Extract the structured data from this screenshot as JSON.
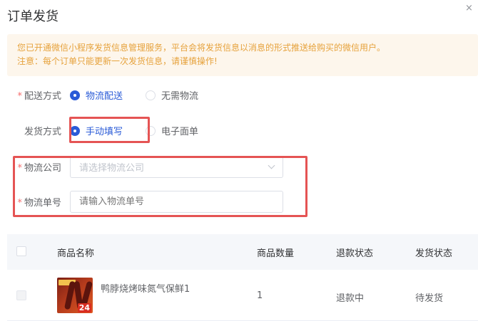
{
  "dialog": {
    "title": "订单发货",
    "close_glyph": "×"
  },
  "notice": {
    "line1": "您已开通微信小程序发货信息管理服务，平台会将发货信息以消息的形式推送给购买的微信用户。",
    "line2": "注意：每个订单只能更新一次发货信息，请谨慎操作!"
  },
  "form": {
    "delivery_type": {
      "label": "配送方式",
      "required": "*",
      "options": [
        "物流配送",
        "无需物流"
      ],
      "selected": "物流配送"
    },
    "ship_method": {
      "label": "发货方式",
      "options": [
        "手动填写",
        "电子面单"
      ],
      "selected": "手动填写"
    },
    "company": {
      "label": "物流公司",
      "required": "*",
      "placeholder": "请选择物流公司"
    },
    "tracking": {
      "label": "物流单号",
      "required": "*",
      "placeholder": "请输入物流单号"
    }
  },
  "table": {
    "headers": [
      "商品名称",
      "商品数量",
      "退款状态",
      "发货状态"
    ],
    "rows": [
      {
        "name": "鸭脖烧烤味氮气保鲜1",
        "qty": "1",
        "refund": "退款中",
        "ship": "待发货",
        "thumb_badge": "24"
      }
    ]
  },
  "colors": {
    "accent": "#2a5bd7",
    "highlight": "#e55454",
    "notice_text": "#e6a23c",
    "notice_bg": "#fdf6ec",
    "required": "#f56c6c"
  },
  "icons": {
    "close": "close-icon",
    "dropdown": "chevron-down-icon",
    "radio": "radio-icon",
    "checkbox": "checkbox-icon"
  }
}
